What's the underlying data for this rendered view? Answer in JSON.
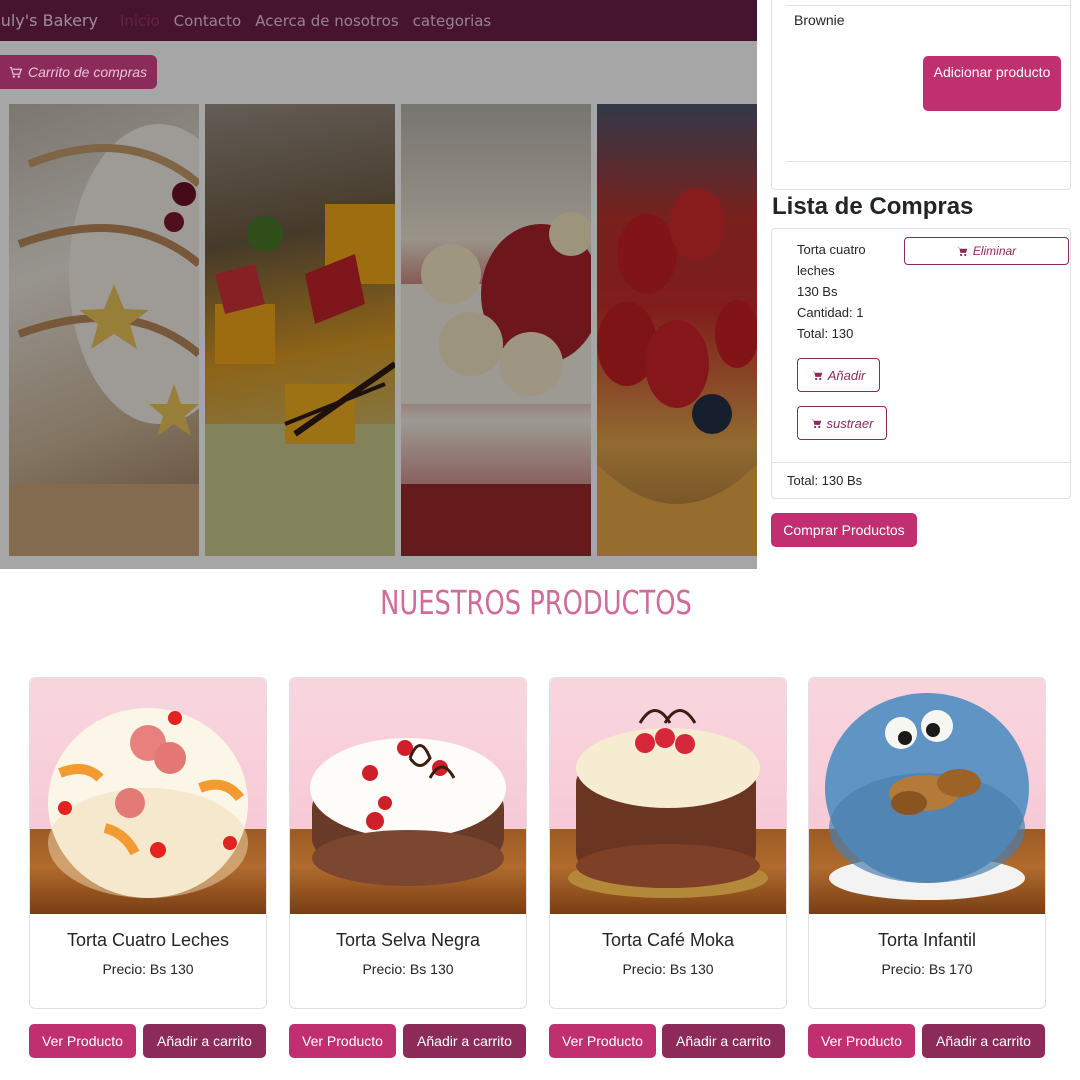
{
  "navbar": {
    "brand": "July's Bakery",
    "links": [
      "Inicio",
      "Contacto",
      "Acerca de nosotros",
      "categorias"
    ]
  },
  "cart_button": {
    "label": "Carrito de compras",
    "icon": "cart-icon"
  },
  "side_panel": {
    "top_item": "Brownie",
    "add_product_label": "Adicionar producto",
    "list_title": "Lista de Compras",
    "cart_item": {
      "name": "Torta cuatro leches",
      "price": "130 Bs",
      "quantity": "Cantidad: 1",
      "total": "Total: 130"
    },
    "remove_label": "Eliminar",
    "increase_label": "Añadir",
    "decrease_label": "sustraer",
    "total_line": "Total:  130 Bs",
    "buy_label": "Comprar Productos"
  },
  "products": {
    "title": "NUESTROS PRODUCTOS",
    "items": [
      {
        "name": "Torta Cuatro Leches",
        "price": "Precio: Bs 130"
      },
      {
        "name": "Torta Selva Negra",
        "price": "Precio: Bs 130"
      },
      {
        "name": "Torta Café Moka",
        "price": "Precio: Bs 130"
      },
      {
        "name": "Torta Infantil",
        "price": "Precio: Bs 170"
      }
    ],
    "view_label": "Ver Producto",
    "add_label": "Añadir a carrito"
  },
  "colors": {
    "primary": "#c03071",
    "dark": "#8c2a5a",
    "navbar": "#6e1f49",
    "title": "#d06b9b"
  }
}
